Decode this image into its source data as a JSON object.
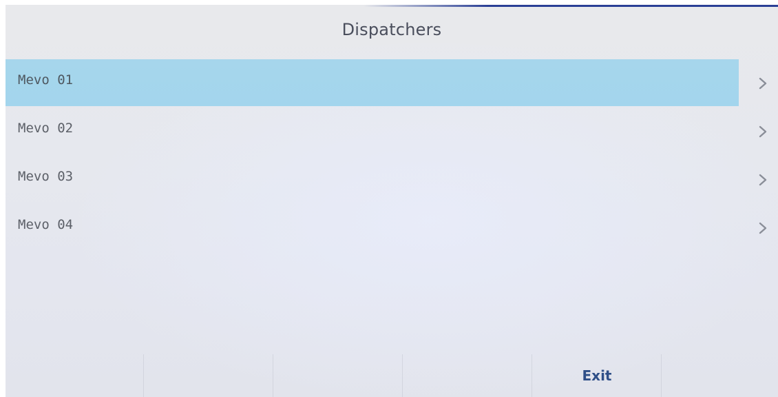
{
  "header": {
    "title": "Dispatchers"
  },
  "list": {
    "items": [
      {
        "label": "Mevo 01",
        "selected": true
      },
      {
        "label": "Mevo 02",
        "selected": false
      },
      {
        "label": "Mevo 03",
        "selected": false
      },
      {
        "label": "Mevo 04",
        "selected": false
      }
    ]
  },
  "footer": {
    "buttons": [
      "",
      "",
      "",
      "",
      "Exit",
      ""
    ],
    "exit_label": "Exit"
  },
  "icons": {
    "row_arrow": "chevron-right-icon"
  },
  "colors": {
    "selected_row": "#a6d6ec",
    "title_text": "#4a4e5c",
    "exit_text": "#2f4f88",
    "screen_bg": "#e6e8ee"
  }
}
